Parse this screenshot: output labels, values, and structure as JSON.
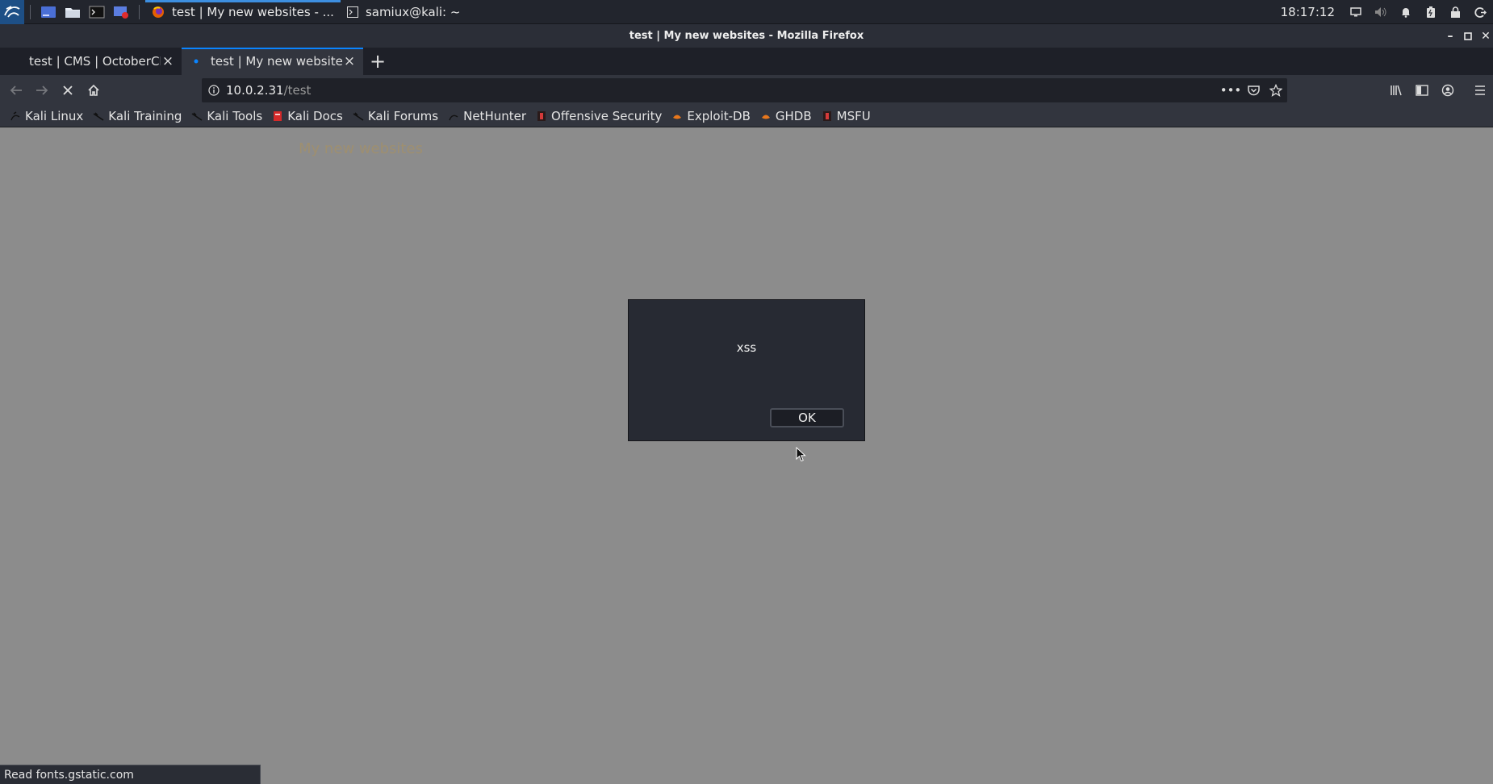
{
  "panel": {
    "tasks": [
      {
        "label": "test | My new websites - ...",
        "icon": "firefox-icon"
      },
      {
        "label": "samiux@kali: ~",
        "icon": "terminal-icon"
      }
    ],
    "clock": "18:17:12"
  },
  "window": {
    "title": "test | My new websites - Mozilla Firefox"
  },
  "tabs": [
    {
      "label": "test | CMS | OctoberCMS"
    },
    {
      "label": "test | My new websites"
    }
  ],
  "navbar": {
    "url_host": "10.0.2.31",
    "url_path": "/test"
  },
  "bookmarks": [
    {
      "label": "Kali Linux"
    },
    {
      "label": "Kali Training"
    },
    {
      "label": "Kali Tools"
    },
    {
      "label": "Kali Docs"
    },
    {
      "label": "Kali Forums"
    },
    {
      "label": "NetHunter"
    },
    {
      "label": "Offensive Security"
    },
    {
      "label": "Exploit-DB"
    },
    {
      "label": "GHDB"
    },
    {
      "label": "MSFU"
    }
  ],
  "page": {
    "site_title": "My new websites"
  },
  "dialog": {
    "message": "xss",
    "ok_label": "OK"
  },
  "status": {
    "text": "Read fonts.gstatic.com"
  },
  "colors": {
    "panel_bg": "#22252d",
    "accent_blue": "#0a84ff",
    "page_bg": "#8c8c8c",
    "site_title": "#9e8f70"
  }
}
